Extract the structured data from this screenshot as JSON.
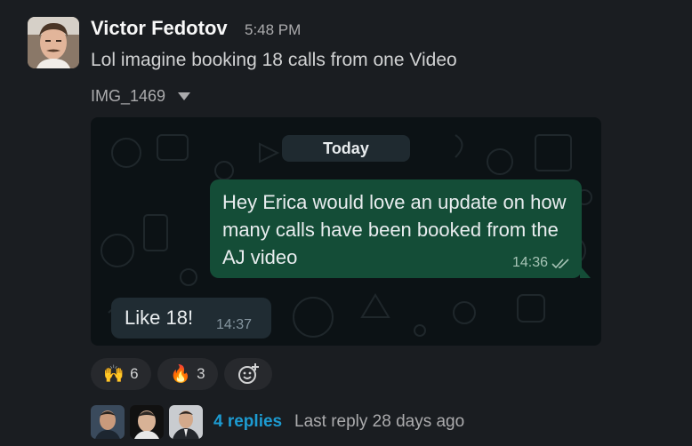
{
  "message": {
    "sender": "Victor Fedotov",
    "time": "5:48 PM",
    "text": "Lol imagine booking 18 calls from one Video",
    "file_name": "IMG_1469"
  },
  "attachment": {
    "day_chip": "Today",
    "outgoing_text": "Hey Erica would love an update on how many calls have been booked from the AJ video",
    "outgoing_time": "14:36",
    "incoming_text": "Like 18!",
    "incoming_time": "14:37"
  },
  "reactions": [
    {
      "emoji": "🙌",
      "count": "6"
    },
    {
      "emoji": "🔥",
      "count": "3"
    }
  ],
  "thread": {
    "replies_label": "4 replies",
    "last_reply": "Last reply 28 days ago"
  },
  "colors": {
    "background": "#1a1d21",
    "link": "#1d9bd1",
    "outgoing_bubble": "#144d37",
    "incoming_bubble": "#202c33"
  },
  "icons": [
    "chevron-down-icon",
    "double-check-icon",
    "add-reaction-icon"
  ]
}
